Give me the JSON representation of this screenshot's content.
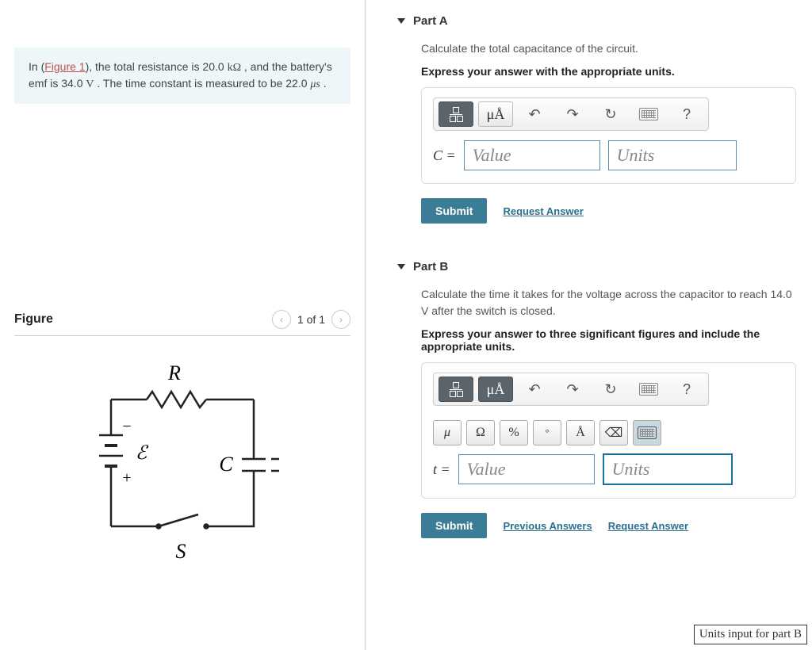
{
  "problem": {
    "prefix": "In (",
    "figure_link": "Figure 1",
    "text_after_link": "), the total resistance is 20.0 ",
    "unit1": "kΩ",
    "text2": " , and the battery's emf is 34.0 ",
    "unit2": "V",
    "text3": " . The time constant is measured to be 22.0 ",
    "unit3": "μs",
    "text4": " ."
  },
  "figure": {
    "title": "Figure",
    "counter": "1 of 1",
    "labels": {
      "R": "R",
      "C": "C",
      "S": "S",
      "emf": "ℰ",
      "plus": "+",
      "minus": "−"
    }
  },
  "partA": {
    "title": "Part A",
    "prompt": "Calculate the total capacitance of the circuit.",
    "instruct": "Express your answer with the appropriate units.",
    "units_tool": "μÅ",
    "var": "C =",
    "value_ph": "Value",
    "units_ph": "Units",
    "submit": "Submit",
    "request": "Request Answer"
  },
  "partB": {
    "title": "Part B",
    "prompt": "Calculate the time it takes for the voltage across the capacitor to reach 14.0 V after the switch is closed.",
    "instruct": "Express your answer to three significant figures and include the appropriate units.",
    "units_tool": "μÅ",
    "symbols": {
      "mu": "μ",
      "omega": "Ω",
      "pct": "%",
      "deg": "°",
      "ang": "Å",
      "del": "⌫"
    },
    "var": "t =",
    "value_ph": "Value",
    "units_ph": "Units",
    "submit": "Submit",
    "prev": "Previous Answers",
    "request": "Request Answer",
    "tooltip": "Units input for part B"
  },
  "help_glyph": "?"
}
